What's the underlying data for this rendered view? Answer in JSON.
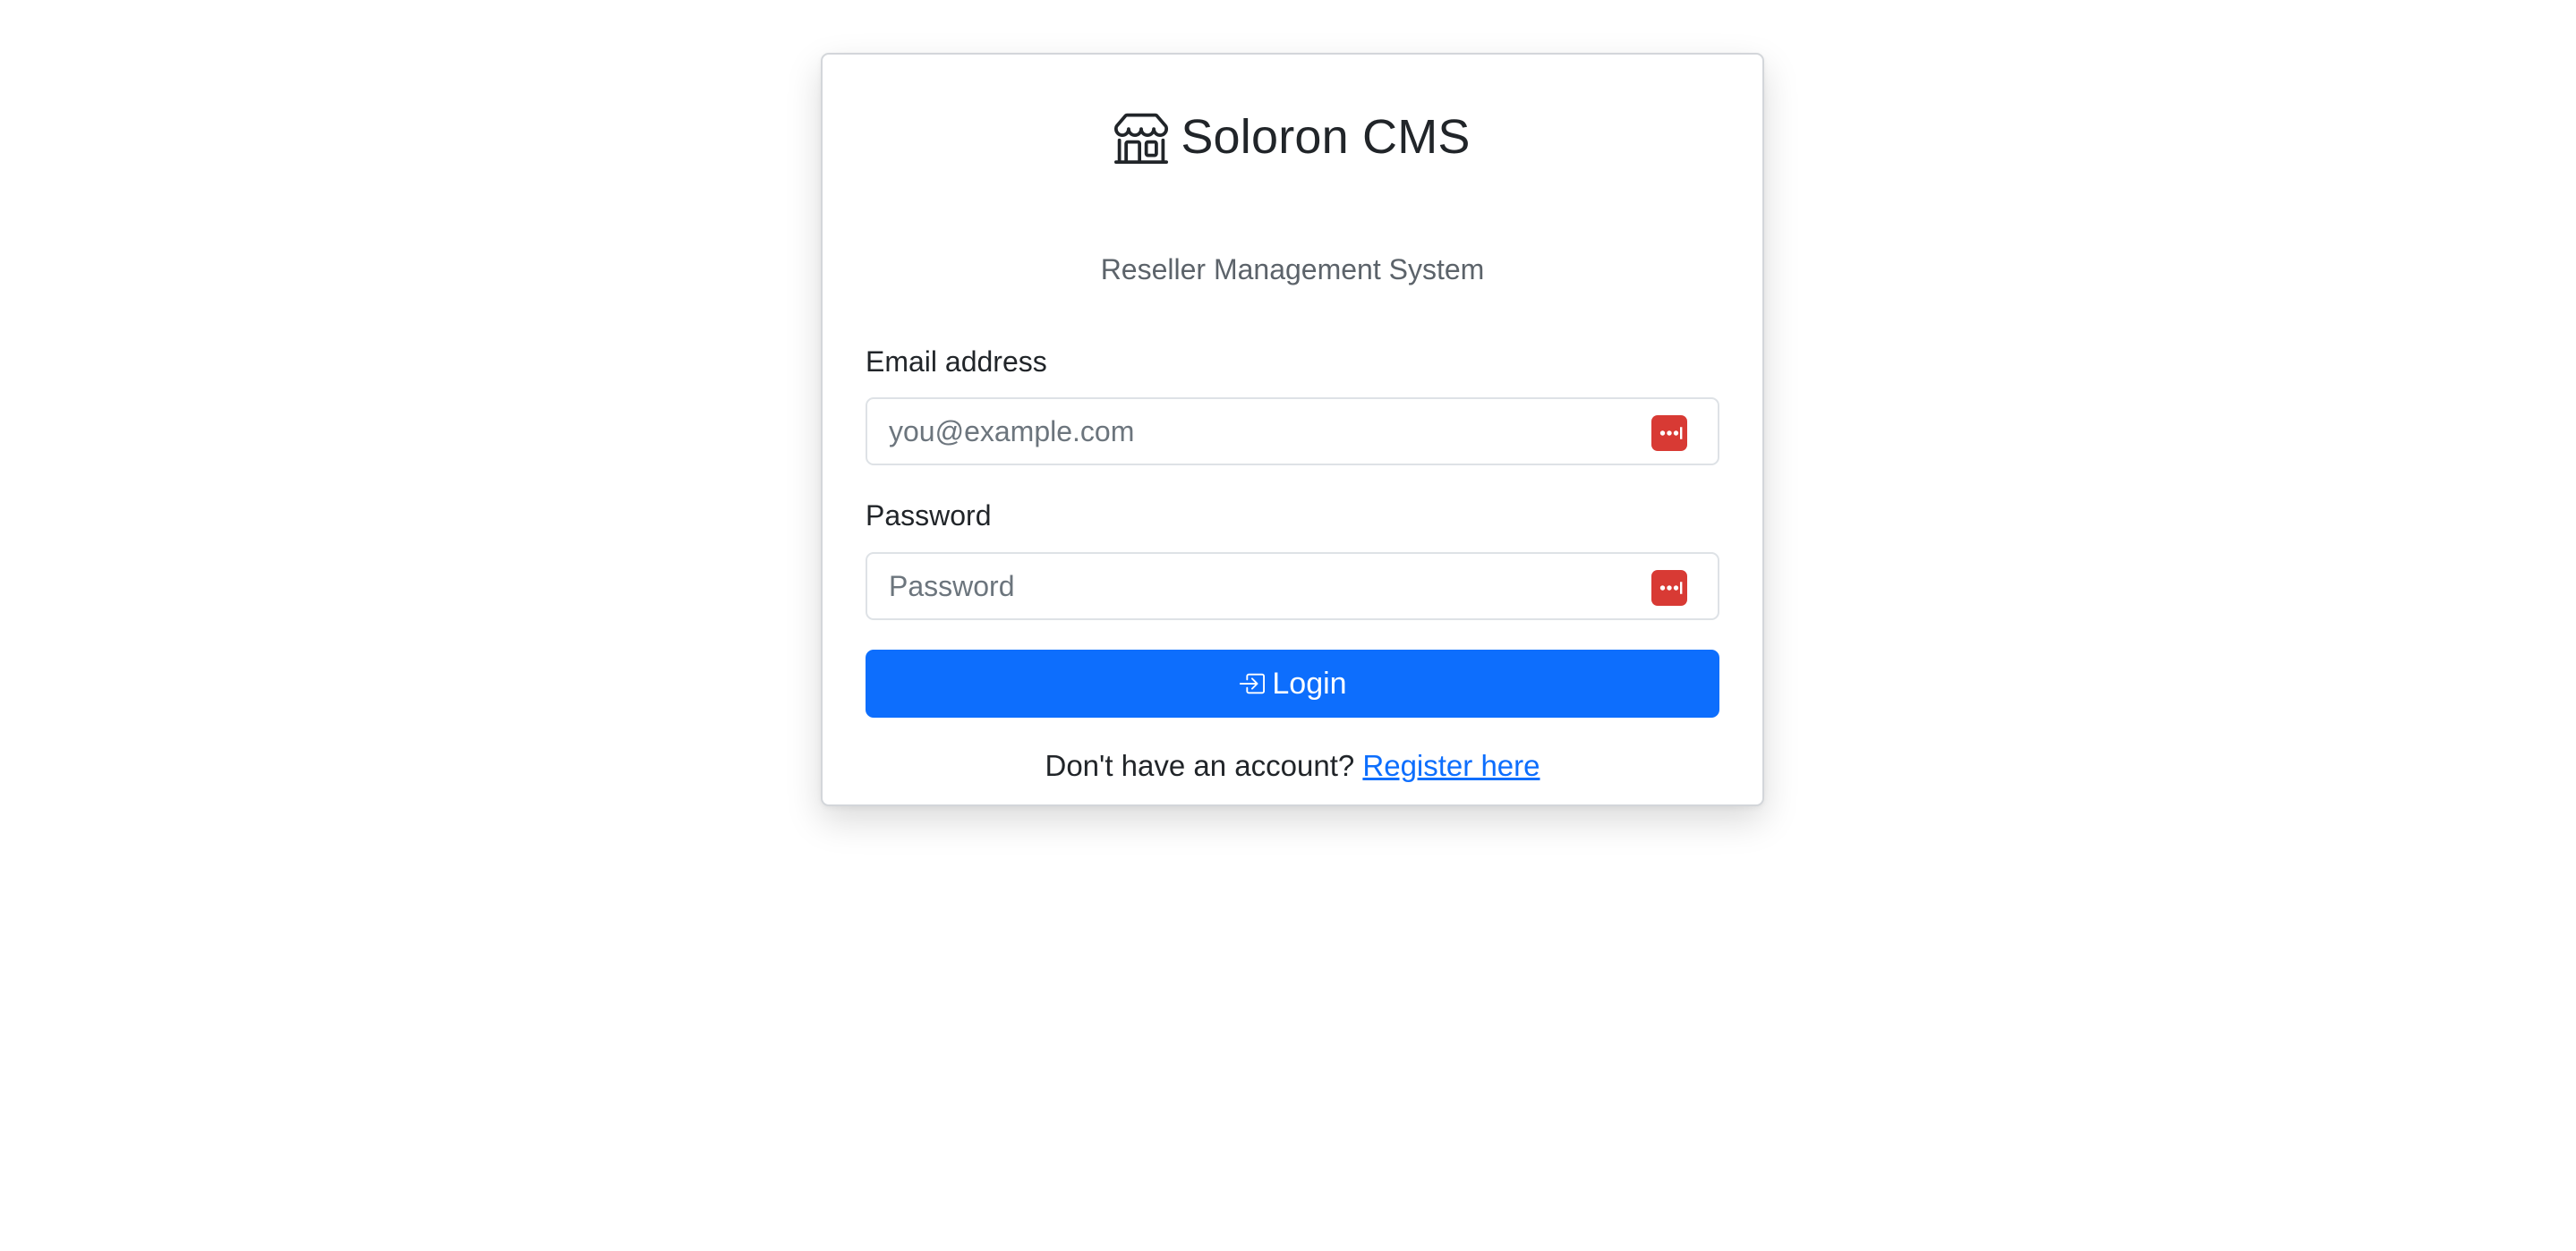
{
  "app": {
    "title": "Soloron CMS",
    "subtitle": "Reseller Management System",
    "icon": "shop-icon"
  },
  "form": {
    "email": {
      "label": "Email address",
      "value": "",
      "placeholder": "you@example.com",
      "autofill_icon": "password-manager-icon"
    },
    "password": {
      "label": "Password",
      "value": "",
      "placeholder": "Password",
      "autofill_icon": "password-manager-icon"
    },
    "login_button": {
      "label": "Login",
      "icon": "box-arrow-in-right-icon"
    }
  },
  "register": {
    "prompt": "Don't have an account?",
    "link_text": "Register here"
  },
  "colors": {
    "primary": "#0d6efd",
    "password_manager": "#d83a34",
    "muted_text": "#5c636a"
  }
}
